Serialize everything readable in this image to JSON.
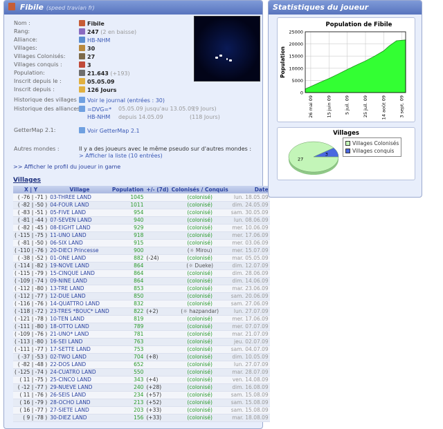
{
  "left_panel": {
    "title": "Fibile",
    "subtitle": "(speed travian fr)"
  },
  "info": {
    "nom_label": "Nom :",
    "nom": "Fibile",
    "rang_label": "Rang:",
    "rang": "247",
    "rang_note": "(2 en baisse)",
    "alliance_label": "Alliance:",
    "alliance": "HB-NHM",
    "villages_label": "Villages:",
    "villages": "30",
    "colonises_label": "Villages Colonisés:",
    "colonises": "27",
    "conquis_label": "Villages conquis :",
    "conquis": "3",
    "population_label": "Population:",
    "population": "21.643",
    "population_note": "(+193)",
    "inscrit_label": "Inscrit depuis le :",
    "inscrit": "05.05.09",
    "inscrit_jours_label": "Inscrit depuis :",
    "inscrit_jours": "126 Jours",
    "hist_villages_label": "Historique des villages :",
    "hist_villages_link": "Voir le journal (entrées : 30)",
    "hist_alliances_label": "Historique des alliances :",
    "alliance_hist": [
      {
        "name": "=DVG=*",
        "period": "05.05.09 jusqu'au 13.05.09",
        "days": "(9 Jours)"
      },
      {
        "name": "HB-NHM",
        "period": "depuis 14.05.09",
        "days": "(118 Jours)"
      }
    ],
    "gettermap_label": "GetterMap 2.1:",
    "gettermap_link": "Voir GetterMap 2.1",
    "autres_label": "Autres mondes :",
    "autres_text": "Il y a des joueurs avec le même pseudo sur d'autres mondes :",
    "autres_link": "> Afficher la liste (10 entrées)",
    "profil_link": ">> Afficher le profil du joueur in game"
  },
  "villages_title": "Villages",
  "table": {
    "headers": [
      "X | Y",
      "Village",
      "Population",
      "+/- (7d)",
      "Colonisés / Conquis",
      "Date"
    ],
    "rows": [
      [
        "( -76 | -71 )",
        "03-THREE LAND",
        "1045",
        "",
        "(colonisé)",
        "lun. 18.05.09"
      ],
      [
        "( -82 | -50 )",
        "04-FOUR LAND",
        "1011",
        "",
        "(colonisé)",
        "dim. 24.05.09"
      ],
      [
        "( -83 | -51 )",
        "05-FIVE LAND",
        "954",
        "",
        "(colonisé)",
        "sam. 30.05.09"
      ],
      [
        "( -81 | -44 )",
        "07-SEVEN LAND",
        "940",
        "",
        "(colonisé)",
        "lun. 08.06.09"
      ],
      [
        "( -82 | -45 )",
        "08-EIGHT LAND",
        "929",
        "",
        "(colonisé)",
        "mer. 10.06.09"
      ],
      [
        "( -115 | -75 )",
        "11-UNO LAND",
        "918",
        "",
        "(colonisé)",
        "mer. 17.06.09"
      ],
      [
        "( -81 | -50 )",
        "06-SIX LAND",
        "915",
        "",
        "(colonisé)",
        "mer. 03.06.09"
      ],
      [
        "( -110 | -76 )",
        "20-DIECI Princesse",
        "900",
        "",
        "(☼ Mirou)",
        "mer. 15.07.09"
      ],
      [
        "( -38 | -52 )",
        "01-ONE LAND",
        "882",
        "(-24)",
        "(colonisé)",
        "mar. 05.05.09"
      ],
      [
        "( -114 | -82 )",
        "19-NOVE LAND",
        "864",
        "",
        "(☼ Dueke)",
        "dim. 12.07.09"
      ],
      [
        "( -115 | -79 )",
        "15-CINQUE LAND",
        "864",
        "",
        "(colonisé)",
        "dim. 28.06.09"
      ],
      [
        "( -109 | -74 )",
        "09-NINE LAND",
        "864",
        "",
        "(colonisé)",
        "dim. 14.06.09"
      ],
      [
        "( -112 | -80 )",
        "13-TRE LAND",
        "853",
        "",
        "(colonisé)",
        "mar. 23.06.09"
      ],
      [
        "( -112 | -77 )",
        "12-DUE LAND",
        "850",
        "",
        "(colonisé)",
        "sam. 20.06.09"
      ],
      [
        "( -116 | -76 )",
        "14-QUATTRO LAND",
        "832",
        "",
        "(colonisé)",
        "sam. 27.06.09"
      ],
      [
        "( -118 | -72 )",
        "23-TRES *BOUC* LAND",
        "822",
        "(+2)",
        "(☼ hazpandar)",
        "lun. 27.07.09"
      ],
      [
        "( -121 | -78 )",
        "10-TEN LAND",
        "819",
        "",
        "(colonisé)",
        "mer. 17.06.09"
      ],
      [
        "( -111 | -80 )",
        "18-OTTO LAND",
        "789",
        "",
        "(colonisé)",
        "mer. 07.07.09"
      ],
      [
        "( -109 | -76 )",
        "21-UNO* LAND",
        "781",
        "",
        "(colonisé)",
        "mar. 21.07.09"
      ],
      [
        "( -113 | -80 )",
        "16-SEI LAND",
        "763",
        "",
        "(colonisé)",
        "jeu. 02.07.09"
      ],
      [
        "( -111 | -77 )",
        "17-SETTE LAND",
        "753",
        "",
        "(colonisé)",
        "sam. 04.07.09"
      ],
      [
        "( -37 | -53 )",
        "02-TWO LAND",
        "704",
        "(+8)",
        "(colonisé)",
        "dim. 10.05.09"
      ],
      [
        "( -82 | -48 )",
        "22-DOS LAND",
        "652",
        "",
        "(colonisé)",
        "lun. 27.07.09"
      ],
      [
        "( -125 | -74 )",
        "24-CUATRO LAND",
        "550",
        "",
        "(colonisé)",
        "mar. 28.07.09"
      ],
      [
        "( 11 | -75 )",
        "25-CINCO LAND",
        "343",
        "(+4)",
        "(colonisé)",
        "ven. 14.08.09"
      ],
      [
        "( -12 | -77 )",
        "29-NUEVE LAND",
        "240",
        "(+28)",
        "(colonisé)",
        "dim. 16.08.09"
      ],
      [
        "( 11 | -76 )",
        "26-SEIS LAND",
        "234",
        "(+57)",
        "(colonisé)",
        "sam. 15.08.09"
      ],
      [
        "( 16 | -79 )",
        "28-OCHO LAND",
        "213",
        "(+52)",
        "(colonisé)",
        "sam. 15.08.09"
      ],
      [
        "( 16 | -77 )",
        "27-SIETE LAND",
        "203",
        "(+33)",
        "(colonisé)",
        "sam. 15.08.09"
      ],
      [
        "( 9 | -78 )",
        "30-DIEZ LAND",
        "156",
        "(+33)",
        "(colonisé)",
        "mar. 18.08.09"
      ]
    ]
  },
  "right_panel": {
    "title": "Statistiques du joueur"
  },
  "chart_data": [
    {
      "type": "area",
      "title": "Population de Fibile",
      "ylabel": "Population",
      "xlabel": "",
      "ylim": [
        0,
        25000
      ],
      "yticks": [
        "0",
        "5000",
        "10000",
        "15000",
        "20000",
        "25000"
      ],
      "xticks": [
        "26 mai 09",
        "15 juin 09",
        "5 juil. 09",
        "25 juil. 09",
        "14 août 09",
        "3 sept. 09"
      ],
      "x": [
        "2009-05-20",
        "2009-05-26",
        "2009-06-05",
        "2009-06-15",
        "2009-06-25",
        "2009-07-05",
        "2009-07-15",
        "2009-07-25",
        "2009-08-04",
        "2009-08-14",
        "2009-08-20",
        "2009-08-28",
        "2009-09-03",
        "2009-09-07"
      ],
      "values": [
        1500,
        2500,
        4200,
        5800,
        7600,
        9500,
        11300,
        13000,
        15000,
        17200,
        19200,
        21300,
        21500,
        21643
      ],
      "fill": "#33ff33",
      "grid": true
    },
    {
      "type": "pie",
      "title": "Villages",
      "categories": [
        "Villages Colonisés",
        "Villages conquis"
      ],
      "values": [
        27,
        3
      ],
      "colors": [
        "#c3f5b8",
        "#4a68e0"
      ],
      "legend": "right"
    }
  ]
}
